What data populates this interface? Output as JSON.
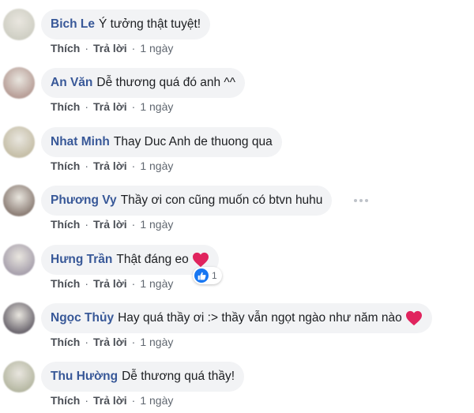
{
  "actions": {
    "like_label": "Thích",
    "reply_label": "Trả lời",
    "separator": "·",
    "time": "1 ngày"
  },
  "colors": {
    "author_link": "#385898",
    "bubble_bg": "#f2f3f5",
    "meta_text": "#606770",
    "heart": "#e0245e",
    "like_blue": "#1877f2"
  },
  "comments": [
    {
      "author": "Bich Le",
      "text": "Ý tưởng thật tuyệt!",
      "avatar_color": "#cfcfc4"
    },
    {
      "author": "An Văn",
      "text": "Dễ thương quá đó anh ^^",
      "avatar_color": "#b89f98"
    },
    {
      "author": "Nhat Minh",
      "text": "Thay Duc Anh de thuong qua",
      "avatar_color": "#c6bfa8"
    },
    {
      "author": "Phương Vy",
      "text": "Thầy ơi con cũng muốn có btvn huhu",
      "avatar_color": "#8e8078",
      "more_icon": "ellipsis-icon"
    },
    {
      "author": "Hưng Trần",
      "text": "Thật đáng eo",
      "avatar_color": "#a9a2ae",
      "trailing_icon": "heart-icon",
      "reaction": {
        "icon": "like-icon",
        "count": "1"
      }
    },
    {
      "author": "Ngọc Thủy",
      "text": "Hay quá thầy ơi :> thầy vẫn ngọt ngào như năm nào",
      "avatar_color": "#6f6a72",
      "trailing_icon": "heart-icon"
    },
    {
      "author": "Thu Hường",
      "text": "Dễ thương quá thầy!",
      "avatar_color": "#b7b9a4"
    }
  ]
}
